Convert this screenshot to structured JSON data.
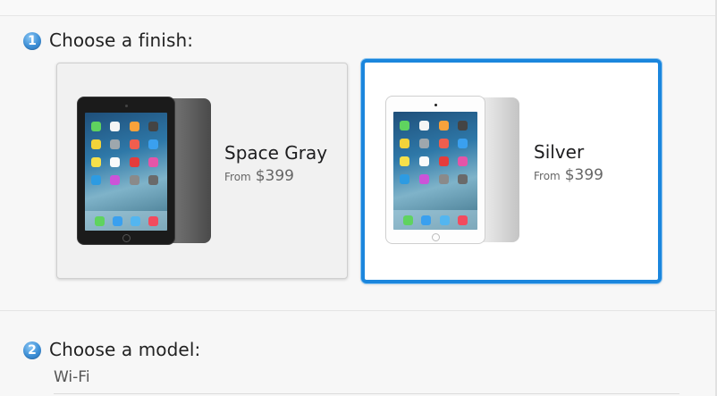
{
  "steps": [
    {
      "number": "1",
      "title": "Choose a finish:"
    },
    {
      "number": "2",
      "title": "Choose a model:"
    }
  ],
  "finishes": [
    {
      "name": "Space Gray",
      "from_label": "From",
      "price": "$399",
      "selected": false
    },
    {
      "name": "Silver",
      "from_label": "From",
      "price": "$399",
      "selected": true
    }
  ],
  "models": [
    {
      "label": "Wi-Fi"
    }
  ],
  "colors": {
    "selected_border": "#1b86dd",
    "step_badge": "#3d8fd6",
    "space_gray_body": "#2b2b2b",
    "silver_body": "#e9e9e9"
  }
}
